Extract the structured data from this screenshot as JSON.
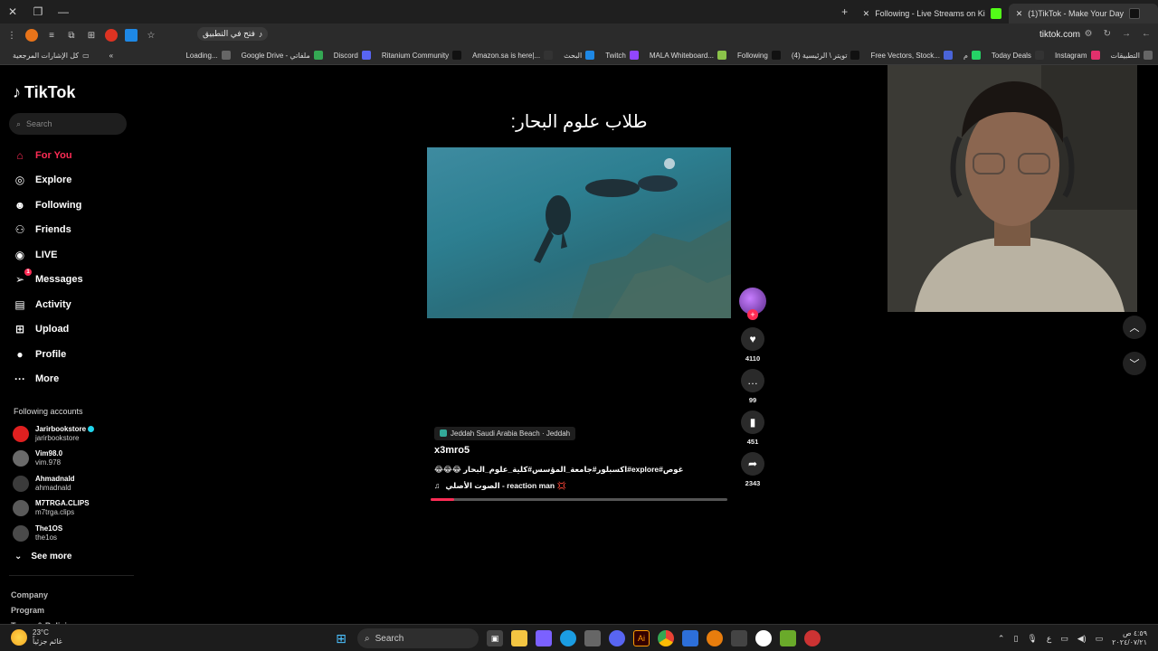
{
  "browser": {
    "tabs": [
      {
        "label": "(1)TikTok - Make Your Day",
        "active": true
      },
      {
        "label": "Following - Live Streams on Ki",
        "active": false
      }
    ],
    "url": "tiktok.com",
    "open_app_label": "فتح في التطبيق",
    "bookmarks_right": [
      "التطبيقات",
      "Instagram",
      "Today Deals",
      "م",
      "Free Vectors, Stock...",
      "(4) تويتر \\ الرئيسية",
      "Following",
      "MALA Whiteboard...",
      "Twitch",
      "البحث",
      "Amazon.sa is here|...",
      "Ritanium Community",
      "Discord",
      "Google Drive - ملفاتي",
      "Loading..."
    ],
    "bookmarks_left": "كل الإشارات المرجعية"
  },
  "sidebar": {
    "logo": "TikTok",
    "search_placeholder": "Search",
    "nav": [
      {
        "label": "For You",
        "icon": "home-icon",
        "active": true
      },
      {
        "label": "Explore",
        "icon": "compass-icon",
        "active": false
      },
      {
        "label": "Following",
        "icon": "following-icon",
        "active": false
      },
      {
        "label": "Friends",
        "icon": "friends-icon",
        "active": false
      },
      {
        "label": "LIVE",
        "icon": "live-icon",
        "active": false
      },
      {
        "label": "Messages",
        "icon": "messages-icon",
        "badge": "1",
        "active": false
      },
      {
        "label": "Activity",
        "icon": "activity-icon",
        "active": false
      },
      {
        "label": "Upload",
        "icon": "upload-icon",
        "active": false
      },
      {
        "label": "Profile",
        "icon": "profile-icon",
        "active": false
      },
      {
        "label": "More",
        "icon": "more-icon",
        "active": false
      }
    ],
    "following_title": "Following accounts",
    "accounts": [
      {
        "display": "Jarirbookstore",
        "handle": "jarirbookstore",
        "verified": true
      },
      {
        "display": "Vim98.0",
        "handle": "vim.978",
        "verified": false
      },
      {
        "display": "Ahmadnald",
        "handle": "ahmadnald",
        "verified": false
      },
      {
        "display": "M7TRGA.CLIPS",
        "handle": "m7trga.clips",
        "verified": false
      },
      {
        "display": "The1OS",
        "handle": "the1os",
        "verified": false
      }
    ],
    "see_more": "See more",
    "footer": [
      "Company",
      "Program",
      "Terms & Policies"
    ]
  },
  "video": {
    "title": "طلاب علوم البحار:",
    "location": "Jeddah Saudi Arabia Beach · Jeddah",
    "username": "x3mro5",
    "caption": "غوص#explore#اكسبلور#جامعة_المؤسس#كلية_علوم_البحار 😂😂😂",
    "music": "الصوت الأصلي - reaction man 💢",
    "music_icon": "♫",
    "progress": 0.08
  },
  "actions": {
    "likes": "4110",
    "comments": "99",
    "saves": "451",
    "shares": "2343"
  },
  "taskbar": {
    "temp": "23°C",
    "weather_desc": "غائم جزئياً",
    "search_label": "Search",
    "time": "٤:٥٩ ص",
    "date": "٢٠٢٤/٠٧/٢١",
    "lang": "ع"
  },
  "colors": {
    "accent": "#fe2c55",
    "bg": "#000000"
  }
}
